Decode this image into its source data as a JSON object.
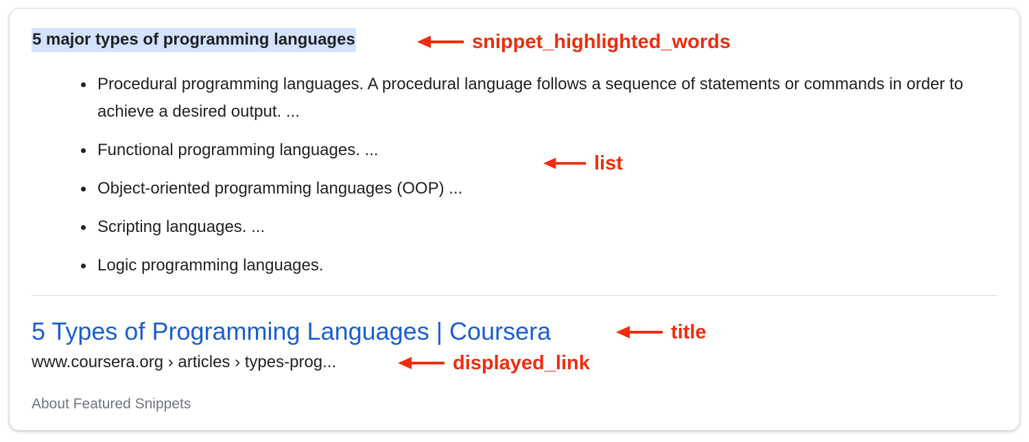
{
  "snippet": {
    "highlighted_heading": "5 major types of programming languages",
    "list_items": [
      "Procedural programming languages. A procedural language follows a sequence of statements or commands in order to achieve a desired output. ...",
      "Functional programming languages. ...",
      "Object-oriented programming languages (OOP) ...",
      "Scripting languages. ...",
      "Logic programming languages."
    ]
  },
  "result": {
    "title": "5 Types of Programming Languages | Coursera",
    "displayed_link": "www.coursera.org › articles › types-prog..."
  },
  "footer": {
    "about_label": "About Featured Snippets"
  },
  "annotations": {
    "highlighted_words": "snippet_highlighted_words",
    "list": "list",
    "title": "title",
    "displayed_link": "displayed_link"
  },
  "colors": {
    "highlight_bg": "#d3e3fd",
    "title_link": "#1a5fcc",
    "annotation": "#ee2d0c",
    "body_text": "#202124",
    "muted_text": "#70757a"
  },
  "icons": {
    "annotation_arrow": "left-arrow-icon",
    "bullet": "bullet-dot-icon"
  }
}
